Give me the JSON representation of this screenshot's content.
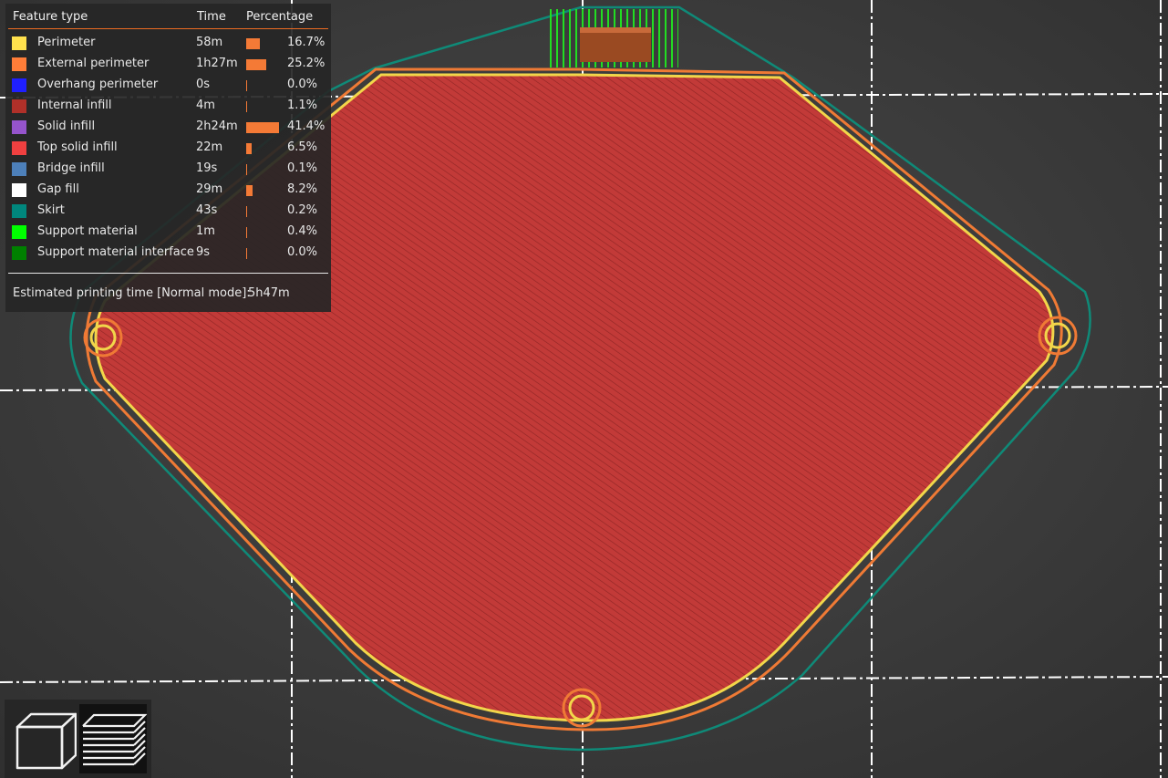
{
  "colors": {
    "bed": "#3a3a3a",
    "grid": "#ffffff",
    "infill": "#c03838",
    "perimeter": "#f2d64a",
    "external_perimeter": "#ef7a35",
    "skirt": "#0f8a78",
    "support": "#22dd22",
    "legend_accent": "#ed6b21"
  },
  "legend": {
    "headers": {
      "feature": "Feature type",
      "time": "Time",
      "percentage": "Percentage"
    },
    "rows": [
      {
        "label": "Perimeter",
        "time": "58m",
        "pct": "16.7%",
        "value": 0.167,
        "color": "#ffe14d"
      },
      {
        "label": "External perimeter",
        "time": "1h27m",
        "pct": "25.2%",
        "value": 0.252,
        "color": "#ff7d38"
      },
      {
        "label": "Overhang perimeter",
        "time": "0s",
        "pct": "0.0%",
        "value": 0.0,
        "color": "#1f1fff"
      },
      {
        "label": "Internal infill",
        "time": "4m",
        "pct": "1.1%",
        "value": 0.011,
        "color": "#b03029"
      },
      {
        "label": "Solid infill",
        "time": "2h24m",
        "pct": "41.4%",
        "value": 0.414,
        "color": "#9654cc"
      },
      {
        "label": "Top solid infill",
        "time": "22m",
        "pct": "6.5%",
        "value": 0.065,
        "color": "#f04040"
      },
      {
        "label": "Bridge infill",
        "time": "19s",
        "pct": "0.1%",
        "value": 0.001,
        "color": "#4d80ba"
      },
      {
        "label": "Gap fill",
        "time": "29m",
        "pct": "8.2%",
        "value": 0.082,
        "color": "#ffffff"
      },
      {
        "label": "Skirt",
        "time": "43s",
        "pct": "0.2%",
        "value": 0.002,
        "color": "#00877d"
      },
      {
        "label": "Support material",
        "time": "1m",
        "pct": "0.4%",
        "value": 0.004,
        "color": "#00ff00"
      },
      {
        "label": "Support material interface",
        "time": "9s",
        "pct": "0.0%",
        "value": 0.0,
        "color": "#008000"
      }
    ],
    "estimated_label": "Estimated printing time [Normal mode]:",
    "estimated_value": "5h47m"
  },
  "view_buttons": [
    {
      "name": "3d-view",
      "icon": "cube-icon",
      "active": false
    },
    {
      "name": "layers-view",
      "icon": "layers-icon",
      "active": true
    }
  ]
}
